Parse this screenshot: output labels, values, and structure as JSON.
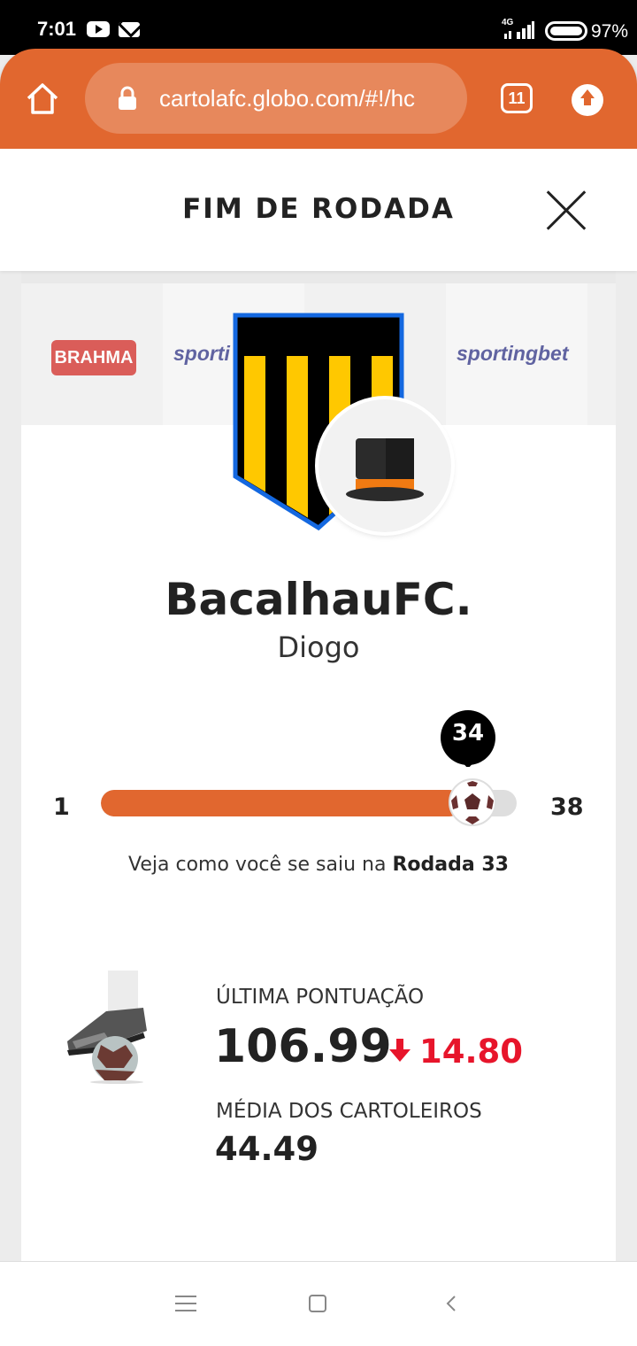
{
  "status_bar": {
    "time": "7:01",
    "network": "4G",
    "battery": "97%",
    "icons": [
      "youtube-icon",
      "mail-icon",
      "signal-icon",
      "battery-icon"
    ]
  },
  "browser": {
    "url": "cartolafc.globo.com/#!/hc",
    "tab_count": "11",
    "accent_color": "#e1672f"
  },
  "modal": {
    "title": "FIM DE RODADA"
  },
  "banner": {
    "sponsors": [
      "BRAHMA",
      "sporti",
      "sportingbet"
    ]
  },
  "team": {
    "name": "BacalhauFC.",
    "owner": "Diogo"
  },
  "rounds": {
    "min": "1",
    "max": "38",
    "current": "34",
    "progress_fraction": 0.868,
    "caption_prefix": "Veja como você se saiu na",
    "caption_round": "Rodada 33"
  },
  "scores": {
    "last_label": "ÚLTIMA PONTUAÇÃO",
    "last_value": "106.99",
    "delta_value": "14.80",
    "delta_direction": "down",
    "delta_color": "#e7152b",
    "avg_label": "MÉDIA DOS CARTOLEIROS",
    "avg_value": "44.49"
  }
}
